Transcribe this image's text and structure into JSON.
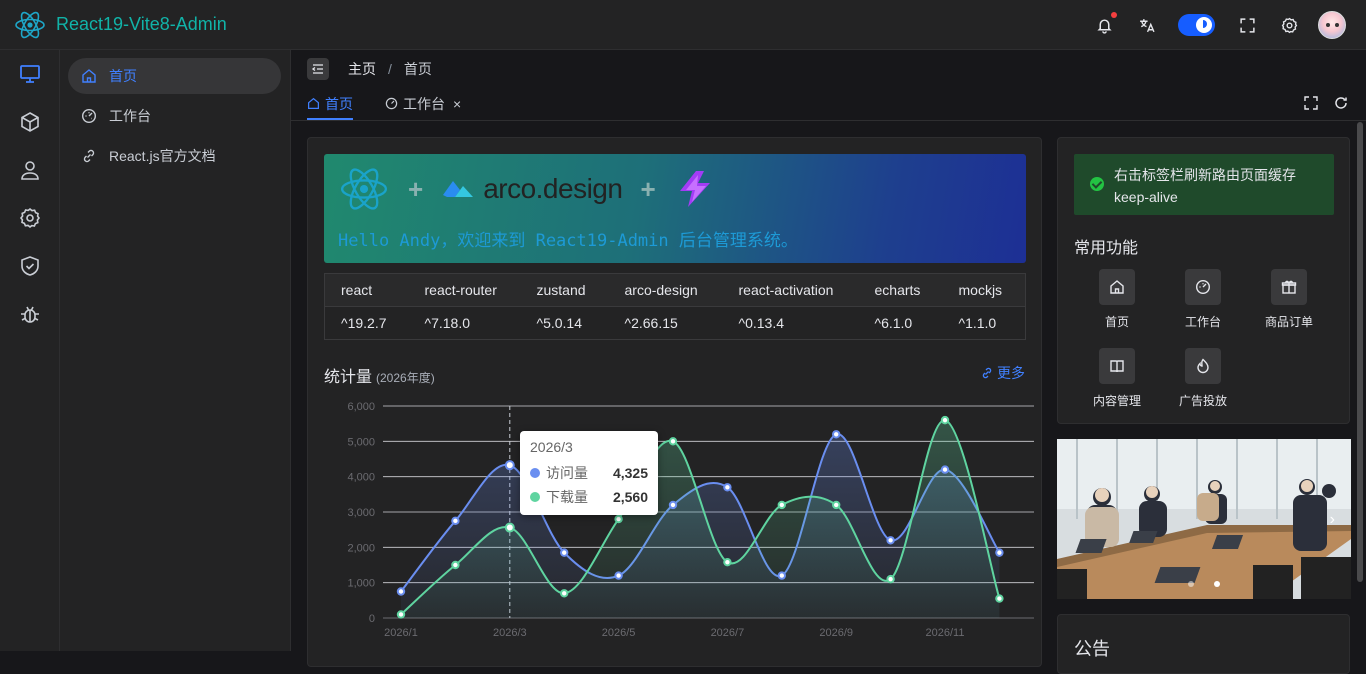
{
  "header": {
    "app_title": "React19-Vite8-Admin",
    "icons": [
      "bell-icon",
      "translate-icon",
      "theme-toggle",
      "fullscreen-icon",
      "settings-icon",
      "avatar"
    ],
    "notification_dot_color": "#f53f3f"
  },
  "rail": {
    "items": [
      "monitor-icon",
      "cube-icon",
      "user-icon",
      "gear-icon",
      "shield-icon",
      "bug-icon"
    ],
    "active_index": 0
  },
  "menu": {
    "items": [
      {
        "label": "首页",
        "icon": "home-icon",
        "active": true
      },
      {
        "label": "工作台",
        "icon": "dashboard-icon",
        "active": false
      },
      {
        "label": "React.js官方文档",
        "icon": "link-icon",
        "active": false
      }
    ]
  },
  "breadcrumb": {
    "root": "主页",
    "sep": "/",
    "current": "首页"
  },
  "tabs": [
    {
      "label": "首页",
      "icon": "home-icon",
      "active": true
    },
    {
      "label": "工作台",
      "icon": "dashboard-icon",
      "active": false,
      "close": "×"
    }
  ],
  "banner": {
    "plus": "+",
    "arco_text": "arco.design",
    "welcome": "Hello Andy，欢迎来到 React19-Admin 后台管理系统。"
  },
  "deps": {
    "headers": [
      "react",
      "react-router",
      "zustand",
      "arco-design",
      "react-activation",
      "echarts",
      "mockjs"
    ],
    "values": [
      "^19.2.7",
      "^7.18.0",
      "^5.0.14",
      "^2.66.15",
      "^0.13.4",
      "^6.1.0",
      "^1.1.0"
    ]
  },
  "stats": {
    "title": "统计量",
    "subtitle": "(2026年度)",
    "more": "更多"
  },
  "chart_data": {
    "type": "line",
    "smooth": true,
    "area": true,
    "x": [
      "2026/1",
      "2026/2",
      "2026/3",
      "2026/4",
      "2026/5",
      "2026/6",
      "2026/7",
      "2026/8",
      "2026/9",
      "2026/10",
      "2026/11",
      "2026/12"
    ],
    "xtick_labels": [
      "2026/1",
      "2026/3",
      "2026/5",
      "2026/7",
      "2026/9",
      "2026/11"
    ],
    "ylim": [
      0,
      6000
    ],
    "yticks": [
      "0",
      "1,000",
      "2,000",
      "3,000",
      "4,000",
      "5,000",
      "6,000"
    ],
    "grid": true,
    "series": [
      {
        "name": "访问量",
        "color": "#6a8ef0",
        "values": [
          750,
          2750,
          4325,
          1850,
          1200,
          3200,
          3700,
          1200,
          5200,
          2200,
          4200,
          1850
        ]
      },
      {
        "name": "下载量",
        "color": "#5fd4a0",
        "values": [
          100,
          1500,
          2560,
          700,
          2800,
          5000,
          1580,
          3200,
          3200,
          1100,
          5600,
          550
        ]
      }
    ],
    "tooltip": {
      "title": "2026/3",
      "index": 2,
      "rows": [
        {
          "name": "访问量",
          "value": "4,325"
        },
        {
          "name": "下载量",
          "value": "2,560"
        }
      ]
    }
  },
  "right": {
    "alert": "右击标签栏刷新路由页面缓存 keep-alive",
    "functions_title": "常用功能",
    "functions": [
      {
        "label": "首页",
        "icon": "home-icon"
      },
      {
        "label": "工作台",
        "icon": "dashboard-icon"
      },
      {
        "label": "商品订单",
        "icon": "gift-icon"
      },
      {
        "label": "内容管理",
        "icon": "book-icon"
      },
      {
        "label": "广告投放",
        "icon": "fire-icon"
      }
    ],
    "carousel_next": "›",
    "notice_title": "公告"
  }
}
